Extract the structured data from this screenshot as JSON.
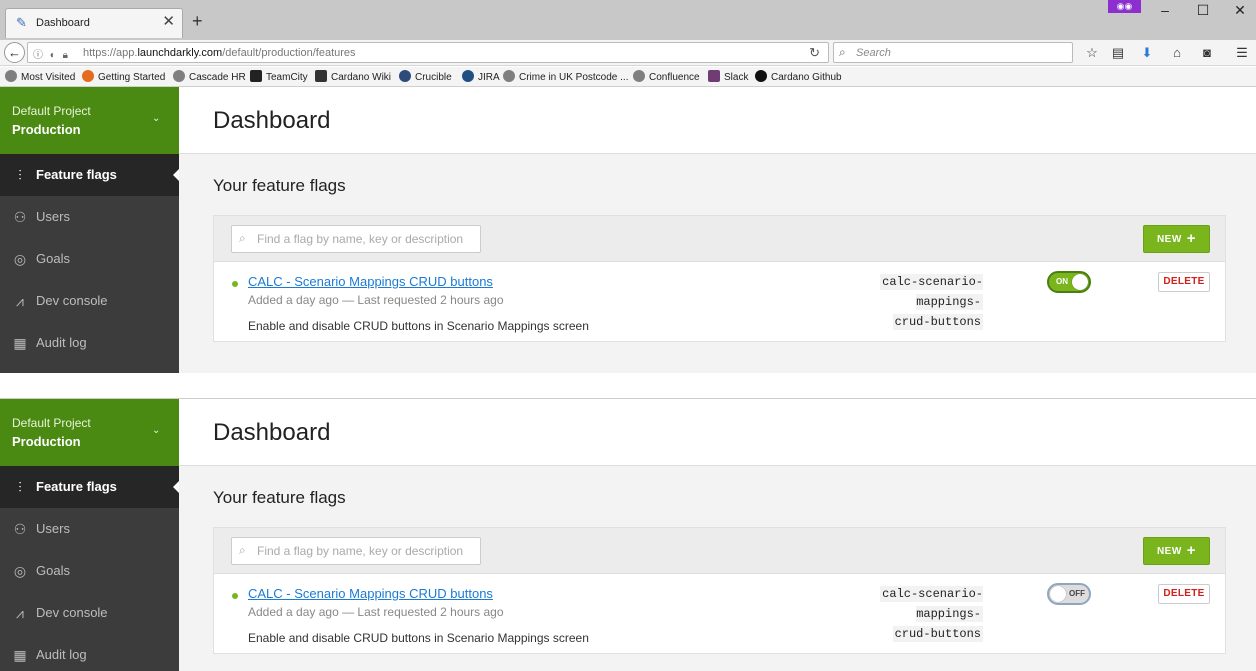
{
  "browser": {
    "tab_title": "Dashboard",
    "url_prefix": "https://app.",
    "url_domain": "launchdarkly.com",
    "url_path": "/default/production/features",
    "search_placeholder": "Search",
    "bookmarks": [
      "Most Visited",
      "Getting Started",
      "Cascade HR",
      "TeamCity",
      "Cardano Wiki",
      "Crucible",
      "JIRA",
      "Crime in UK Postcode ...",
      "Confluence",
      "Slack",
      "Cardano Github"
    ]
  },
  "screens": [
    {
      "project": {
        "name": "Default Project",
        "environment": "Production"
      },
      "nav": [
        {
          "label": "Feature flags",
          "icon": "sliders-icon"
        },
        {
          "label": "Users",
          "icon": "users-icon"
        },
        {
          "label": "Goals",
          "icon": "target-icon"
        },
        {
          "label": "Dev console",
          "icon": "chart-icon"
        },
        {
          "label": "Audit log",
          "icon": "document-icon"
        }
      ],
      "page_title": "Dashboard",
      "section_title": "Your feature flags",
      "search_placeholder": "Find a flag by name, key or description",
      "new_button": "NEW",
      "flag": {
        "name": "CALC - Scenario Mappings CRUD buttons",
        "meta": "Added a day ago — Last requested 2 hours ago",
        "description": "Enable and disable CRUD buttons in Scenario Mappings screen",
        "key_line1": "calc-scenario-mappings-",
        "key_line2": "crud-buttons",
        "toggle": "ON",
        "delete_label": "DELETE"
      }
    },
    {
      "project": {
        "name": "Default Project",
        "environment": "Production"
      },
      "nav": [
        {
          "label": "Feature flags",
          "icon": "sliders-icon"
        },
        {
          "label": "Users",
          "icon": "users-icon"
        },
        {
          "label": "Goals",
          "icon": "target-icon"
        },
        {
          "label": "Dev console",
          "icon": "chart-icon"
        },
        {
          "label": "Audit log",
          "icon": "document-icon"
        }
      ],
      "page_title": "Dashboard",
      "section_title": "Your feature flags",
      "search_placeholder": "Find a flag by name, key or description",
      "new_button": "NEW",
      "flag": {
        "name": "CALC - Scenario Mappings CRUD buttons",
        "meta": "Added a day ago — Last requested 2 hours ago",
        "description": "Enable and disable CRUD buttons in Scenario Mappings screen",
        "key_line1": "calc-scenario-mappings-",
        "key_line2": "crud-buttons",
        "toggle": "OFF",
        "delete_label": "DELETE"
      }
    }
  ],
  "colors": {
    "brand_green": "#4a8a13",
    "accent_green": "#7ab51d",
    "sidebar": "#3c3c3c",
    "link": "#1a7bd6",
    "danger": "#d0201b"
  }
}
